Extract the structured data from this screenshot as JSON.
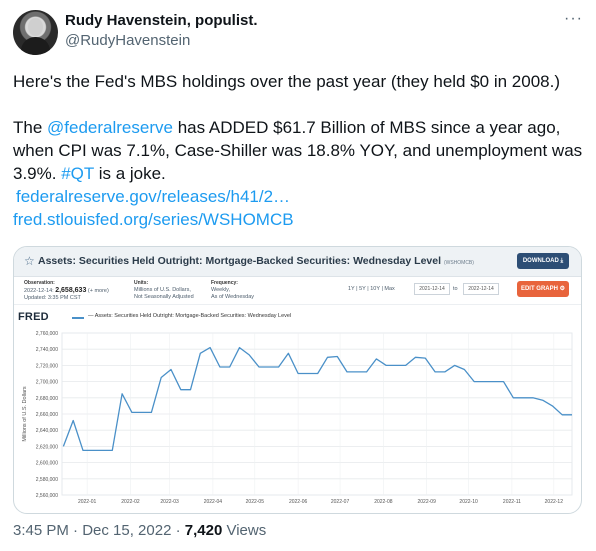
{
  "tweet": {
    "author_name": "Rudy Havenstein, populist.",
    "author_handle": "@RudyHavenstein",
    "more_label": "···",
    "paragraph1": "Here's the Fed's MBS holdings over the past year (they held $0 in 2008.)",
    "p2_part1": "The ",
    "p2_mention": "@federalreserve",
    "p2_part2": " has ADDED $61.7 Billion of MBS since a year ago, when CPI was 7.1%, Case-Shiller was 18.8% YOY, and unemployment was 3.9%. ",
    "p2_hashtag": "#QT",
    "p2_part3": " is a joke.",
    "link1": "federalreserve.gov/releases/h41/2…",
    "link2": "fred.stlouisfed.org/series/WSHOMCB",
    "footer_time": "3:45 PM · Dec 15, 2022 · ",
    "footer_views": "7,420",
    "footer_views_label": " Views"
  },
  "fred": {
    "title": "Assets: Securities Held Outright: Mortgage-Backed Securities: Wednesday Level",
    "code": "(WSHOMCB)",
    "download_label": "DOWNLOAD",
    "edit_label": "EDIT GRAPH",
    "obs_label": "Observation:",
    "obs_date": "2022-12-14:",
    "obs_value": "2,658,633",
    "obs_more": "(+ more)",
    "updated": "Updated: 3:35 PM CST",
    "units_label": "Units:",
    "units_line1": "Millions of U.S. Dollars,",
    "units_line2": "Not Seasonally Adjusted",
    "freq_label": "Frequency:",
    "freq_line1": "Weekly,",
    "freq_line2": "As of Wednesday",
    "range_buttons": "1Y | 5Y | 10Y | Max",
    "date_from": "2021-12-14",
    "to_label": "to",
    "date_to": "2022-12-14",
    "logo": "FRED",
    "legend": "— Assets: Securities Held Outright: Mortgage-Backed Securities: Wednesday Level"
  },
  "chart_data": {
    "type": "line",
    "ylabel": "Millions of U.S. Dollars",
    "ylim": [
      2560000,
      2760000
    ],
    "yticks": [
      "2,560,000",
      "2,580,000",
      "2,600,000",
      "2,620,000",
      "2,640,000",
      "2,660,000",
      "2,680,000",
      "2,700,000",
      "2,720,000",
      "2,740,000",
      "2,760,000"
    ],
    "xticks": [
      "2022-01",
      "2022-02",
      "2022-03",
      "2022-04",
      "2022-05",
      "2022-06",
      "2022-07",
      "2022-08",
      "2022-09",
      "2022-10",
      "2022-11",
      "2022-12"
    ],
    "series": [
      {
        "color": "#4a90c8",
        "points": [
          [
            "2021-12-15",
            2620000
          ],
          [
            "2021-12-22",
            2652000
          ],
          [
            "2021-12-29",
            2615000
          ],
          [
            "2022-01-05",
            2615000
          ],
          [
            "2022-01-12",
            2615000
          ],
          [
            "2022-01-19",
            2615000
          ],
          [
            "2022-01-26",
            2685000
          ],
          [
            "2022-02-02",
            2662000
          ],
          [
            "2022-02-09",
            2662000
          ],
          [
            "2022-02-16",
            2662000
          ],
          [
            "2022-02-23",
            2705000
          ],
          [
            "2022-03-02",
            2715000
          ],
          [
            "2022-03-09",
            2690000
          ],
          [
            "2022-03-16",
            2690000
          ],
          [
            "2022-03-23",
            2735000
          ],
          [
            "2022-03-30",
            2742000
          ],
          [
            "2022-04-06",
            2718000
          ],
          [
            "2022-04-13",
            2718000
          ],
          [
            "2022-04-20",
            2742000
          ],
          [
            "2022-04-27",
            2733000
          ],
          [
            "2022-05-04",
            2718000
          ],
          [
            "2022-05-11",
            2718000
          ],
          [
            "2022-05-18",
            2718000
          ],
          [
            "2022-05-25",
            2735000
          ],
          [
            "2022-06-01",
            2710000
          ],
          [
            "2022-06-08",
            2710000
          ],
          [
            "2022-06-15",
            2710000
          ],
          [
            "2022-06-22",
            2730000
          ],
          [
            "2022-06-29",
            2731000
          ],
          [
            "2022-07-06",
            2712000
          ],
          [
            "2022-07-13",
            2712000
          ],
          [
            "2022-07-20",
            2712000
          ],
          [
            "2022-07-27",
            2728000
          ],
          [
            "2022-08-03",
            2720000
          ],
          [
            "2022-08-10",
            2720000
          ],
          [
            "2022-08-17",
            2720000
          ],
          [
            "2022-08-24",
            2730000
          ],
          [
            "2022-08-31",
            2729000
          ],
          [
            "2022-09-07",
            2712000
          ],
          [
            "2022-09-14",
            2712000
          ],
          [
            "2022-09-21",
            2720000
          ],
          [
            "2022-09-28",
            2715000
          ],
          [
            "2022-10-05",
            2700000
          ],
          [
            "2022-10-12",
            2700000
          ],
          [
            "2022-10-19",
            2700000
          ],
          [
            "2022-10-26",
            2700000
          ],
          [
            "2022-11-02",
            2680000
          ],
          [
            "2022-11-09",
            2680000
          ],
          [
            "2022-11-16",
            2680000
          ],
          [
            "2022-11-23",
            2677000
          ],
          [
            "2022-11-30",
            2670000
          ],
          [
            "2022-12-07",
            2659000
          ],
          [
            "2022-12-14",
            2659000
          ]
        ]
      }
    ],
    "grid": true
  },
  "colors": {
    "link": "#1d9bf0",
    "muted": "#536471",
    "line": "#4a90c8",
    "download_button": "#2d4e75",
    "edit_button": "#e8643c"
  },
  "icons": {
    "more": "more-horizontal-icon",
    "star": "star-icon",
    "download": "download-icon",
    "edit": "gear-icon"
  }
}
